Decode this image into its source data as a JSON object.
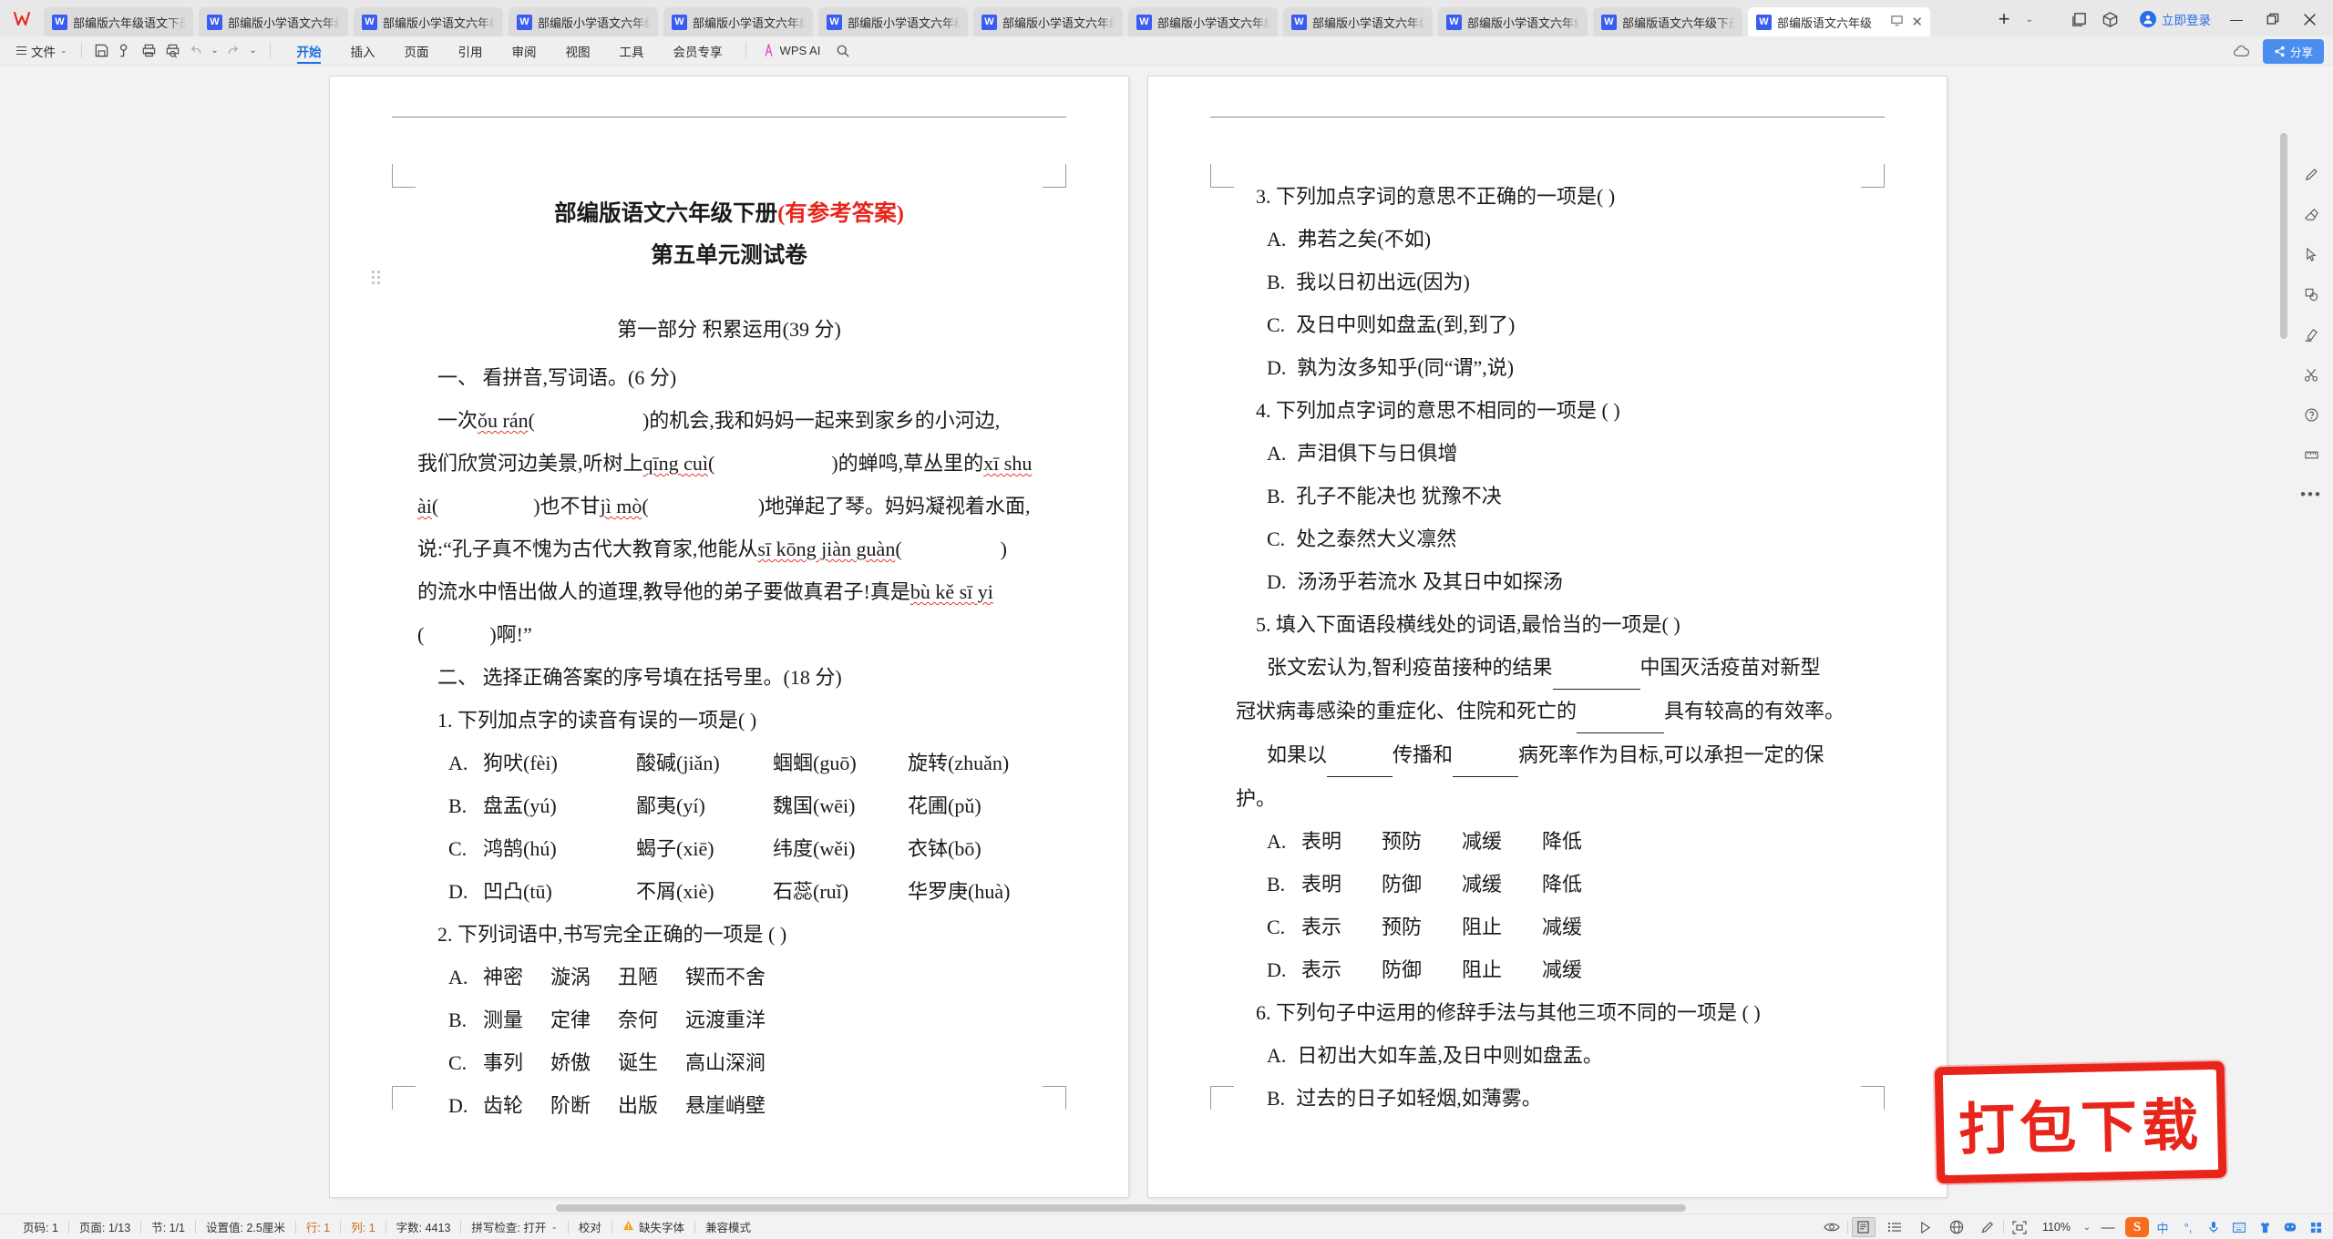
{
  "app": {
    "logo_icon": "wps-logo-icon",
    "new_tab_icon": "plus-icon",
    "tab_dropdown_icon": "chevron-down-icon",
    "window_list_icon": "window-list-icon",
    "cube_icon": "cube-icon",
    "login_label": "立即登录",
    "avatar_icon": "user-avatar-icon",
    "minimize_icon": "minimize-icon",
    "restore_icon": "restore-icon",
    "close_icon": "close-icon"
  },
  "tabs": [
    {
      "label": "部编版六年级语文下册第",
      "icon": "word-doc-icon",
      "active": false
    },
    {
      "label": "部编版小学语文六年级下",
      "icon": "word-doc-icon",
      "active": false
    },
    {
      "label": "部编版小学语文六年级下",
      "icon": "word-doc-icon",
      "active": false
    },
    {
      "label": "部编版小学语文六年级下",
      "icon": "word-doc-icon",
      "active": false
    },
    {
      "label": "部编版小学语文六年级下",
      "icon": "word-doc-icon",
      "active": false
    },
    {
      "label": "部编版小学语文六年级下",
      "icon": "word-doc-icon",
      "active": false
    },
    {
      "label": "部编版小学语文六年级下",
      "icon": "word-doc-icon",
      "active": false
    },
    {
      "label": "部编版小学语文六年级下",
      "icon": "word-doc-icon",
      "active": false
    },
    {
      "label": "部编版小学语文六年级下",
      "icon": "word-doc-icon",
      "active": false
    },
    {
      "label": "部编版小学语文六年级下",
      "icon": "word-doc-icon",
      "active": false
    },
    {
      "label": "部编版语文六年级下册第",
      "icon": "word-doc-icon",
      "active": false
    },
    {
      "label": "部编版语文六年级",
      "icon": "word-doc-icon",
      "active": true
    }
  ],
  "menubar": {
    "file_label": "文件",
    "quick_icons": [
      "save-icon",
      "search-doc-icon",
      "print-icon",
      "print-preview-icon",
      "undo-icon",
      "redo-icon",
      "customize-icon"
    ],
    "ribbon_tabs": [
      {
        "label": "开始",
        "active": true
      },
      {
        "label": "插入",
        "active": false
      },
      {
        "label": "页面",
        "active": false
      },
      {
        "label": "引用",
        "active": false
      },
      {
        "label": "审阅",
        "active": false
      },
      {
        "label": "视图",
        "active": false
      },
      {
        "label": "工具",
        "active": false
      },
      {
        "label": "会员专享",
        "active": false
      }
    ],
    "wps_ai_label": "WPS AI",
    "search_icon": "search-icon",
    "cloud_icon": "cloud-icon",
    "share_label": "分享",
    "share_icon": "share-icon"
  },
  "document": {
    "title_black": "部编版语文六年级下册",
    "title_red": "(有参考答案)",
    "subtitle": "第五单元测试卷",
    "left_page": {
      "section": "第一部分  积累运用(39 分)",
      "q1_head": "一、  看拼音,写词语。(6 分)",
      "p1_a": "一次",
      "p1_py1": "ǒu rán",
      "p1_b": ")的机会,我和妈妈一起来到家乡的小河边,",
      "p2_a": "我们欣赏河边美景,听树上",
      "p2_py": "qīng cuì",
      "p2_b": ")的蝉鸣,草丛里的",
      "p2_py2": "xī shu",
      "p3_py": "ài",
      "p3_a": ")也不甘",
      "p3_py2": "jì mò",
      "p3_b": ")地弹起了琴。妈妈凝视着水面,",
      "p4_a": "说:“孔子真不愧为古代大教育家,他能从",
      "p4_py": "sī kōng jiàn guàn",
      "p5_a": "的流水中悟出做人的道理,教导他的弟子要做真君子!真是",
      "p5_py": "bù kě sī yi",
      "p6": ")啊!”",
      "q2_head": "二、  选择正确答案的序号填在括号里。(18 分)",
      "q1": "1. 下列加点字的读音有误的一项是(        )",
      "q1_options": [
        {
          "label": "A.",
          "items": [
            "狗吠(fèi)",
            "酸碱(jiǎn)",
            "蝈蝈(guō)",
            "旋转(zhuǎn)"
          ]
        },
        {
          "label": "B.",
          "items": [
            "盘盂(yú)",
            "鄙夷(yí)",
            "魏国(wēi)",
            "花圃(pǔ)"
          ]
        },
        {
          "label": "C.",
          "items": [
            "鸿鹄(hú)",
            "蝎子(xiē)",
            "纬度(wěi)",
            "衣钵(bō)"
          ]
        },
        {
          "label": "D.",
          "items": [
            "凹凸(tū)",
            "不屑(xiè)",
            "石蕊(ruǐ)",
            "华罗庚(huà)"
          ]
        }
      ],
      "q2": "2. 下列词语中,书写完全正确的一项是 (      )",
      "q2_options": [
        {
          "label": "A.",
          "items": [
            "神密",
            "漩涡",
            "丑陋",
            "锲而不舍"
          ]
        },
        {
          "label": "B.",
          "items": [
            "测量",
            "定律",
            "奈何",
            "远渡重洋"
          ]
        },
        {
          "label": "C.",
          "items": [
            "事列",
            "娇傲",
            "诞生",
            "高山深涧"
          ]
        },
        {
          "label": "D.",
          "items": [
            "齿轮",
            "阶断",
            "出版",
            "悬崖峭壁"
          ]
        }
      ]
    },
    "right_page": {
      "q3": "3. 下列加点字词的意思不正确的一项是(        )",
      "q3_options": [
        {
          "label": "A.",
          "text": "弗若之矣(不如)"
        },
        {
          "label": "B.",
          "text": "我以日初出远(因为)"
        },
        {
          "label": "C.",
          "text": "及日中则如盘盂(到,到了)"
        },
        {
          "label": "D.",
          "text": "孰为汝多知乎(同“谓”,说)"
        }
      ],
      "q4": "4. 下列加点字词的意思不相同的一项是 (       )",
      "q4_options": [
        {
          "label": "A.",
          "text": "声泪俱下与日俱增"
        },
        {
          "label": "B.",
          "text": "孔子不能决也   犹豫不决"
        },
        {
          "label": "C.",
          "text": "处之泰然大义凛然"
        },
        {
          "label": "D.",
          "text": "汤汤乎若流水  及其日中如探汤"
        }
      ],
      "q5": "5. 填入下面语段横线处的词语,最恰当的一项是(      )",
      "q5_p1_a": "张文宏认为,智利疫苗接种的结果",
      "q5_p1_b": "中国灭活疫苗对新型",
      "q5_p2_a": "冠状病毒感染的重症化、住院和死亡的",
      "q5_p2_b": "具有较高的有效率。",
      "q5_p3_a": "如果以",
      "q5_p3_b": "传播和",
      "q5_p3_c": "病死率作为目标,可以承担一定的保",
      "q5_p4": "护。",
      "q5_options": [
        {
          "label": "A.",
          "items": [
            "表明",
            "预防",
            "减缓",
            "降低"
          ]
        },
        {
          "label": "B.",
          "items": [
            "表明",
            "防御",
            "减缓",
            "降低"
          ]
        },
        {
          "label": "C.",
          "items": [
            "表示",
            "预防",
            "阻止",
            "减缓"
          ]
        },
        {
          "label": "D.",
          "items": [
            "表示",
            "防御",
            "阻止",
            "减缓"
          ]
        }
      ],
      "q6": "6. 下列句子中运用的修辞手法与其他三项不同的一项是 (        )",
      "q6_options": [
        {
          "label": "A.",
          "text": "日初出大如车盖,及日中则如盘盂。"
        },
        {
          "label": "B.",
          "text": "过去的日子如轻烟,如薄雾。"
        }
      ]
    }
  },
  "stamp": {
    "label": "打包下载",
    "color": "#E8251B"
  },
  "statusbar": {
    "left_items": [
      {
        "label": "页码: 1",
        "style": "normal"
      },
      {
        "label": "页面: 1/13",
        "style": "normal"
      },
      {
        "label": "节: 1/1",
        "style": "normal"
      },
      {
        "label": "设置值: 2.5厘米",
        "style": "normal"
      },
      {
        "label": "行: 1",
        "style": "orange"
      },
      {
        "label": "列: 1",
        "style": "orange"
      },
      {
        "label": "字数: 4413",
        "style": "normal"
      },
      {
        "label": "拼写检查: 打开",
        "style": "normal",
        "caret": true
      },
      {
        "label": "校对",
        "style": "normal"
      },
      {
        "label": "缺失字体",
        "style": "normal",
        "icon": "warning-icon"
      },
      {
        "label": "兼容模式",
        "style": "normal"
      }
    ],
    "right": {
      "eye_icon": "eye-icon",
      "view_icons": [
        "page-view-icon",
        "outline-view-icon",
        "reading-view-icon",
        "web-view-icon",
        "edit-view-icon"
      ],
      "fullscreen_icon": "fullscreen-icon",
      "zoom_level": "110%",
      "zoom_caret_icon": "chevron-down-icon",
      "zoom_out_icon": "minus-icon",
      "ime": {
        "brand_icon": "sogou-icon",
        "mode_label": "中",
        "punct_icon": "punctuation-icon",
        "mic_icon": "microphone-icon",
        "keyboard_icon": "keyboard-icon",
        "skin_icon": "skin-icon",
        "emoji_icon": "emoji-icon",
        "apps_icon": "apps-grid-icon"
      }
    }
  },
  "rail_icons": [
    "pen-tool-icon",
    "eraser-icon",
    "cursor-icon",
    "shape-icon",
    "highlight-icon",
    "scissors-icon",
    "help-icon",
    "ruler-icon",
    "more-icon"
  ]
}
